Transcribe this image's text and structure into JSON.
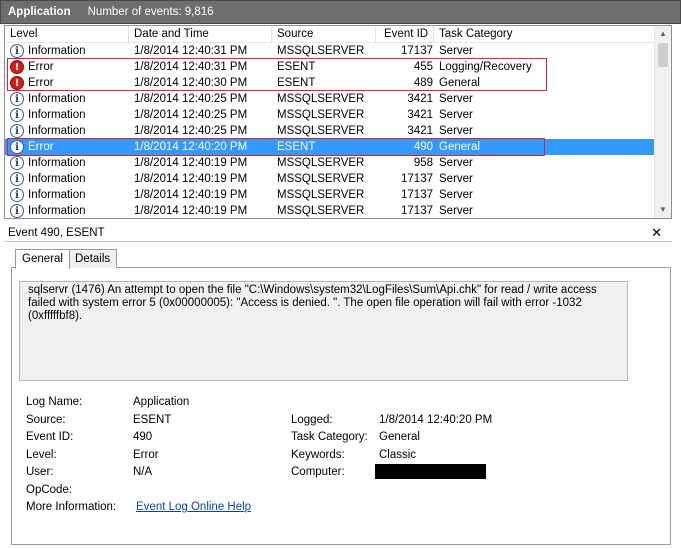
{
  "header": {
    "title": "Application",
    "count_text": "Number of events: 9,816"
  },
  "columns": [
    "Level",
    "Date and Time",
    "Source",
    "Event ID",
    "Task Category"
  ],
  "rows": [
    {
      "icon": "info-icon",
      "level": "Information",
      "date": "1/8/2014 12:40:31 PM",
      "source": "MSSQLSERVER",
      "event_id": "17137",
      "category": "Server"
    },
    {
      "icon": "error-icon",
      "level": "Error",
      "date": "1/8/2014 12:40:31 PM",
      "source": "ESENT",
      "event_id": "455",
      "category": "Logging/Recovery"
    },
    {
      "icon": "error-icon",
      "level": "Error",
      "date": "1/8/2014 12:40:30 PM",
      "source": "ESENT",
      "event_id": "489",
      "category": "General"
    },
    {
      "icon": "info-icon",
      "level": "Information",
      "date": "1/8/2014 12:40:25 PM",
      "source": "MSSQLSERVER",
      "event_id": "3421",
      "category": "Server"
    },
    {
      "icon": "info-icon",
      "level": "Information",
      "date": "1/8/2014 12:40:25 PM",
      "source": "MSSQLSERVER",
      "event_id": "3421",
      "category": "Server"
    },
    {
      "icon": "info-icon",
      "level": "Information",
      "date": "1/8/2014 12:40:25 PM",
      "source": "MSSQLSERVER",
      "event_id": "3421",
      "category": "Server"
    },
    {
      "icon": "info-icon",
      "level": "Error",
      "date": "1/8/2014 12:40:20 PM",
      "source": "ESENT",
      "event_id": "490",
      "category": "General",
      "selected": true
    },
    {
      "icon": "info-icon",
      "level": "Information",
      "date": "1/8/2014 12:40:19 PM",
      "source": "MSSQLSERVER",
      "event_id": "958",
      "category": "Server"
    },
    {
      "icon": "info-icon",
      "level": "Information",
      "date": "1/8/2014 12:40:19 PM",
      "source": "MSSQLSERVER",
      "event_id": "17137",
      "category": "Server"
    },
    {
      "icon": "info-icon",
      "level": "Information",
      "date": "1/8/2014 12:40:19 PM",
      "source": "MSSQLSERVER",
      "event_id": "17137",
      "category": "Server"
    },
    {
      "icon": "info-icon",
      "level": "Information",
      "date": "1/8/2014 12:40:19 PM",
      "source": "MSSQLSERVER",
      "event_id": "17137",
      "category": "Server"
    }
  ],
  "details": {
    "title": "Event 490, ESENT",
    "tabs": [
      "General",
      "Details"
    ],
    "message": "sqlservr (1476) An attempt to open the file \"C:\\Windows\\system32\\LogFiles\\Sum\\Api.chk\" for read / write access failed with system error 5 (0x00000005): \"Access is denied. \".  The open file operation will fail with error -1032 (0xfffffbf8).",
    "labels": {
      "log_name": "Log Name:",
      "source": "Source:",
      "event_id": "Event ID:",
      "level": "Level:",
      "user": "User:",
      "opcode": "OpCode:",
      "more_info": "More Information:",
      "logged": "Logged:",
      "task_category": "Task Category:",
      "keywords": "Keywords:",
      "computer": "Computer:"
    },
    "values": {
      "log_name": "Application",
      "source": "ESENT",
      "event_id": "490",
      "level": "Error",
      "user": "N/A",
      "opcode": "",
      "more_info": "Event Log Online Help",
      "logged": "1/8/2014 12:40:20 PM",
      "task_category": "General",
      "keywords": "Classic",
      "computer": ""
    }
  },
  "colors": {
    "selected": "#3399ff",
    "highlight_border": "#d6233d",
    "error_icon": "#d21d1d",
    "link": "#0645ad"
  }
}
